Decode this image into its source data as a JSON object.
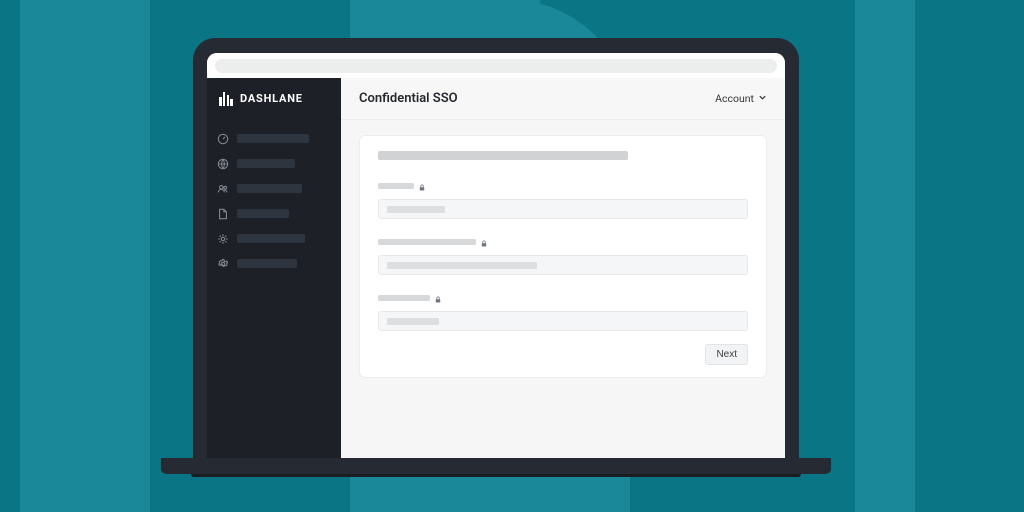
{
  "brand": {
    "name": "DASHLANE"
  },
  "header": {
    "title": "Confidential SSO",
    "account_label": "Account"
  },
  "actions": {
    "next": "Next"
  },
  "sidebar": {
    "items": [
      {
        "icon": "gauge-icon"
      },
      {
        "icon": "globe-icon"
      },
      {
        "icon": "users-icon"
      },
      {
        "icon": "file-icon"
      },
      {
        "icon": "gear-icon"
      },
      {
        "icon": "cog-icon"
      }
    ]
  }
}
